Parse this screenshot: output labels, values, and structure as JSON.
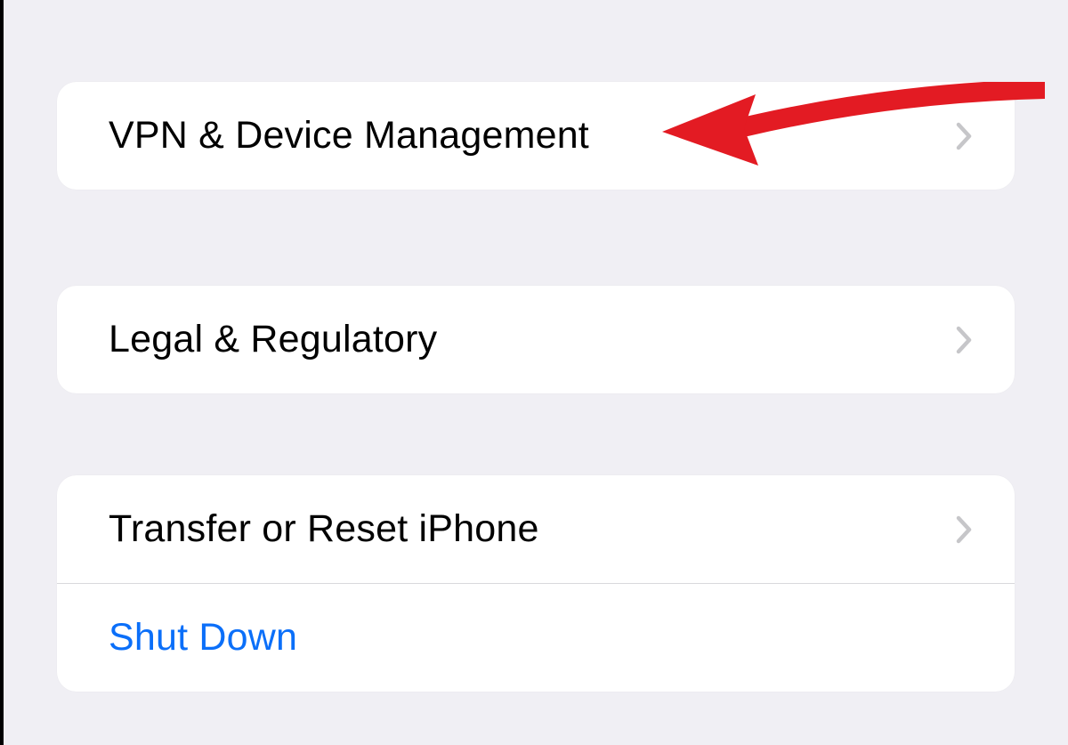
{
  "settings": {
    "groups": [
      {
        "items": [
          {
            "key": "vpn-device-management",
            "label": "VPN & Device Management",
            "chevron": true,
            "link": false
          }
        ]
      },
      {
        "items": [
          {
            "key": "legal-regulatory",
            "label": "Legal & Regulatory",
            "chevron": true,
            "link": false
          }
        ]
      },
      {
        "items": [
          {
            "key": "transfer-reset",
            "label": "Transfer or Reset iPhone",
            "chevron": true,
            "link": false
          },
          {
            "key": "shut-down",
            "label": "Shut Down",
            "chevron": false,
            "link": true
          }
        ]
      }
    ]
  },
  "annotation": {
    "arrow_color": "#e31b23",
    "highlighted_item": "vpn-device-management"
  }
}
